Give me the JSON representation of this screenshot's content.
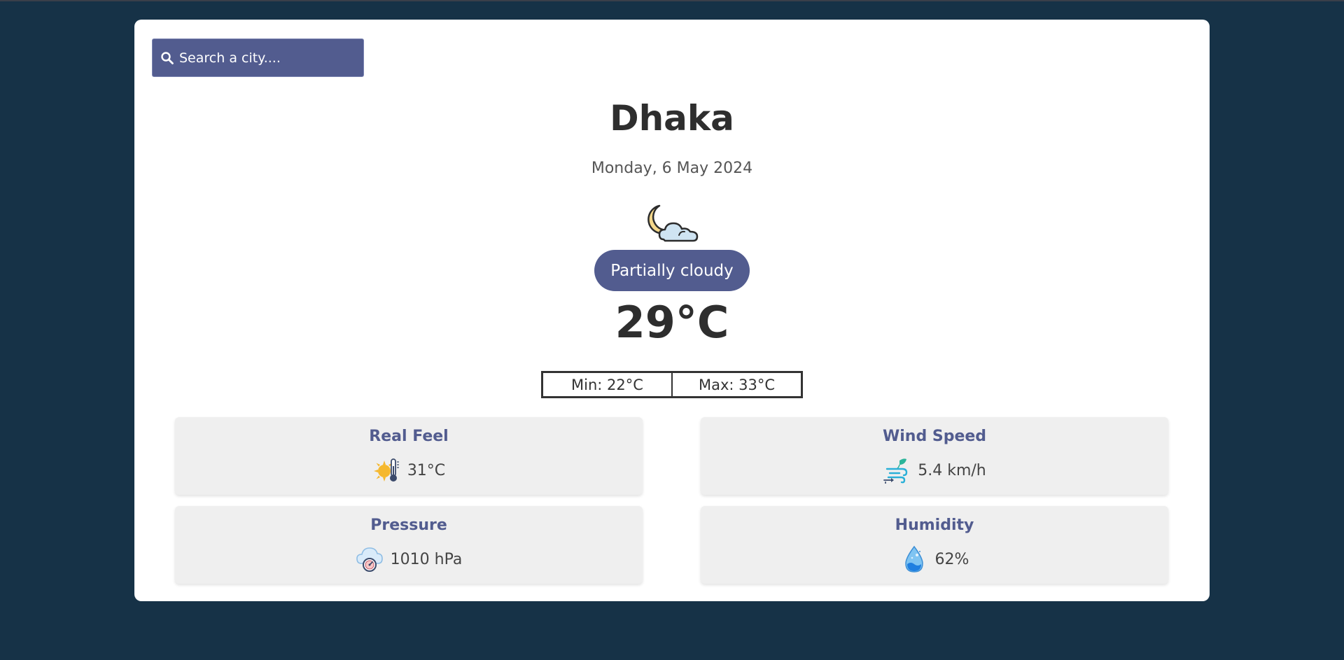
{
  "search": {
    "placeholder": "Search a city....",
    "icon": "search-icon"
  },
  "location": {
    "city": "Dhaka",
    "date": "Monday, 6 May 2024"
  },
  "current": {
    "icon": "moon-cloud-icon",
    "condition": "Partially cloudy",
    "temperature": "29°C",
    "min": "Min: 22°C",
    "max": "Max: 33°C"
  },
  "stats": [
    {
      "label": "Real Feel",
      "value": "31°C",
      "icon": "sun-thermometer-icon"
    },
    {
      "label": "Wind Speed",
      "value": "5.4 km/h",
      "icon": "wind-icon"
    },
    {
      "label": "Pressure",
      "value": "1010 hPa",
      "icon": "pressure-gauge-icon"
    },
    {
      "label": "Humidity",
      "value": "62%",
      "icon": "water-drop-icon"
    }
  ],
  "colors": {
    "background": "#163247",
    "accent": "#525c8f",
    "card": "#ffffff",
    "stat_card": "#efefef"
  }
}
